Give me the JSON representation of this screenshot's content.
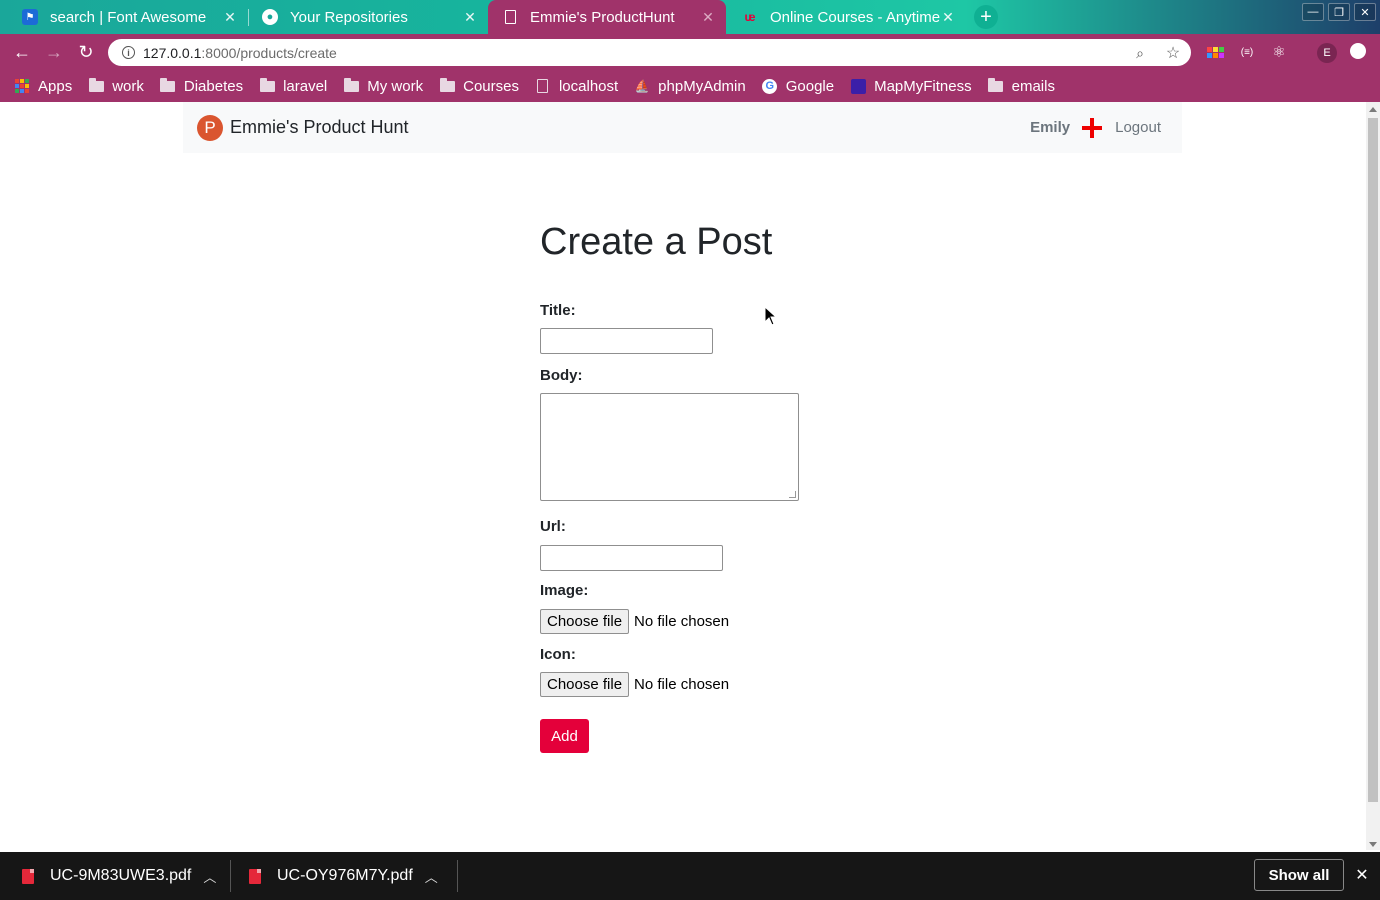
{
  "browser": {
    "tabs": [
      {
        "title": "search | Font Awesome",
        "favicon": "flag-icon",
        "active": false
      },
      {
        "title": "Your Repositories",
        "favicon": "github-icon",
        "active": false
      },
      {
        "title": "Emmie's ProductHunt",
        "favicon": "page-icon",
        "active": true
      },
      {
        "title": "Online Courses - Anytime",
        "favicon": "udemy-icon",
        "active": false
      }
    ],
    "address": {
      "host": "127.0.0.1",
      "path": ":8000/products/create"
    },
    "bookmarks": [
      {
        "label": "Apps",
        "icon": "apps-grid-icon"
      },
      {
        "label": "work",
        "icon": "folder-icon"
      },
      {
        "label": "Diabetes",
        "icon": "folder-icon"
      },
      {
        "label": "laravel",
        "icon": "folder-icon"
      },
      {
        "label": "My work",
        "icon": "folder-icon"
      },
      {
        "label": "Courses",
        "icon": "folder-icon"
      },
      {
        "label": "localhost",
        "icon": "page-icon"
      },
      {
        "label": "phpMyAdmin",
        "icon": "phpmyadmin-icon"
      },
      {
        "label": "Google",
        "icon": "google-icon"
      },
      {
        "label": "MapMyFitness",
        "icon": "mapmyfitness-icon"
      },
      {
        "label": "emails",
        "icon": "folder-icon"
      }
    ],
    "profile_initial": "E"
  },
  "site": {
    "brand_letter": "P",
    "brand_name": "Emmie's Product Hunt",
    "user": "Emily",
    "logout": "Logout"
  },
  "form": {
    "heading": "Create a Post",
    "title_label": "Title:",
    "body_label": "Body:",
    "url_label": "Url:",
    "image_label": "Image:",
    "icon_label": "Icon:",
    "choose_file": "Choose file",
    "no_file": "No file chosen",
    "submit": "Add",
    "values": {
      "title": "",
      "body": "",
      "url": ""
    }
  },
  "downloads": {
    "items": [
      {
        "name": "UC-9M83UWE3.pdf"
      },
      {
        "name": "UC-OY976M7Y.pdf"
      }
    ],
    "show_all": "Show all"
  },
  "colors": {
    "chrome_accent": "#a0336a",
    "brand": "#da552f",
    "add_button": "#e4003a",
    "plus_icon": "#ee0000"
  }
}
